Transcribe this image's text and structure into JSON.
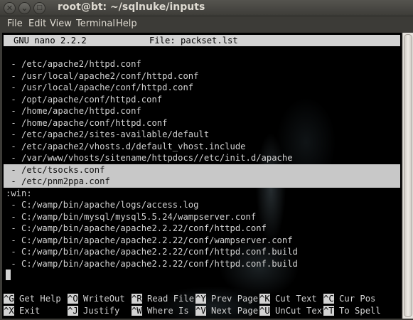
{
  "window": {
    "title": "root@bt: ~/sqlnuke/inputs",
    "buttons": [
      {
        "name": "close-button",
        "glyph": "✕"
      },
      {
        "name": "minimize-button",
        "glyph": "⌄"
      },
      {
        "name": "maximize-button",
        "glyph": "□"
      }
    ]
  },
  "menubar": {
    "items": [
      {
        "name": "menu-file",
        "label": "File"
      },
      {
        "name": "menu-edit",
        "label": "Edit"
      },
      {
        "name": "menu-view",
        "label": "View"
      },
      {
        "name": "menu-terminal",
        "label": "Terminal"
      },
      {
        "name": "menu-help",
        "label": "Help"
      }
    ]
  },
  "nano": {
    "version": "GNU nano 2.2.2",
    "file_label": "File: packset.lst",
    "lines": [
      {
        "text": " - /etc/apache2/httpd.conf",
        "highlight": false
      },
      {
        "text": " - /usr/local/apache2/conf/httpd.conf",
        "highlight": false
      },
      {
        "text": " - /usr/local/apache/conf/httpd.conf",
        "highlight": false
      },
      {
        "text": " - /opt/apache/conf/httpd.conf",
        "highlight": false
      },
      {
        "text": " - /home/apache/httpd.conf",
        "highlight": false
      },
      {
        "text": " - /home/apache/conf/httpd.conf",
        "highlight": false
      },
      {
        "text": " - /etc/apache2/sites-available/default",
        "highlight": false
      },
      {
        "text": " - /etc/apache2/vhosts.d/default_vhost.include",
        "highlight": false
      },
      {
        "text": " - /var/www/vhosts/sitename/httpdocs//etc/init.d/apache",
        "highlight": false
      },
      {
        "text": " - /etc/tsocks.conf",
        "highlight": true
      },
      {
        "text": " - /etc/pnm2ppa.conf",
        "highlight": true
      },
      {
        "text": ":win:",
        "highlight": false
      },
      {
        "text": " - C:/wamp/bin/apache/logs/access.log",
        "highlight": false
      },
      {
        "text": " - C:/wamp/bin/mysql/mysql5.5.24/wampserver.conf",
        "highlight": false
      },
      {
        "text": " - C:/wamp/bin/apache/apache2.2.22/conf/httpd.conf",
        "highlight": false
      },
      {
        "text": " - C:/wamp/bin/apache/apache2.2.22/conf/wampserver.conf",
        "highlight": false
      },
      {
        "text": " - C:/wamp/bin/apache/apache2.2.22/conf/httpd.conf.build",
        "highlight": false
      },
      {
        "text": " - C:/wamp/bin/apache/apache2.2.22/conf/httpd.conf.build",
        "highlight": false
      }
    ],
    "shortcuts_row1": [
      {
        "key": "^G",
        "label": " Get Help"
      },
      {
        "key": "^O",
        "label": " WriteOut"
      },
      {
        "key": "^R",
        "label": " Read File"
      },
      {
        "key": "^Y",
        "label": " Prev Page"
      },
      {
        "key": "^K",
        "label": " Cut Text"
      },
      {
        "key": "^C",
        "label": " Cur Pos"
      }
    ],
    "shortcuts_row2": [
      {
        "key": "^X",
        "label": " Exit"
      },
      {
        "key": "^J",
        "label": " Justify"
      },
      {
        "key": "^W",
        "label": " Where Is"
      },
      {
        "key": "^V",
        "label": " Next Page"
      },
      {
        "key": "^U",
        "label": " UnCut Text"
      },
      {
        "key": "^T",
        "label": " To Spell"
      }
    ]
  },
  "colors": {
    "terminal_bg": "#000000",
    "terminal_fg": "#d3d3d3",
    "chrome_bg": "#3c3b37",
    "chrome_fg": "#dfdbd2"
  }
}
